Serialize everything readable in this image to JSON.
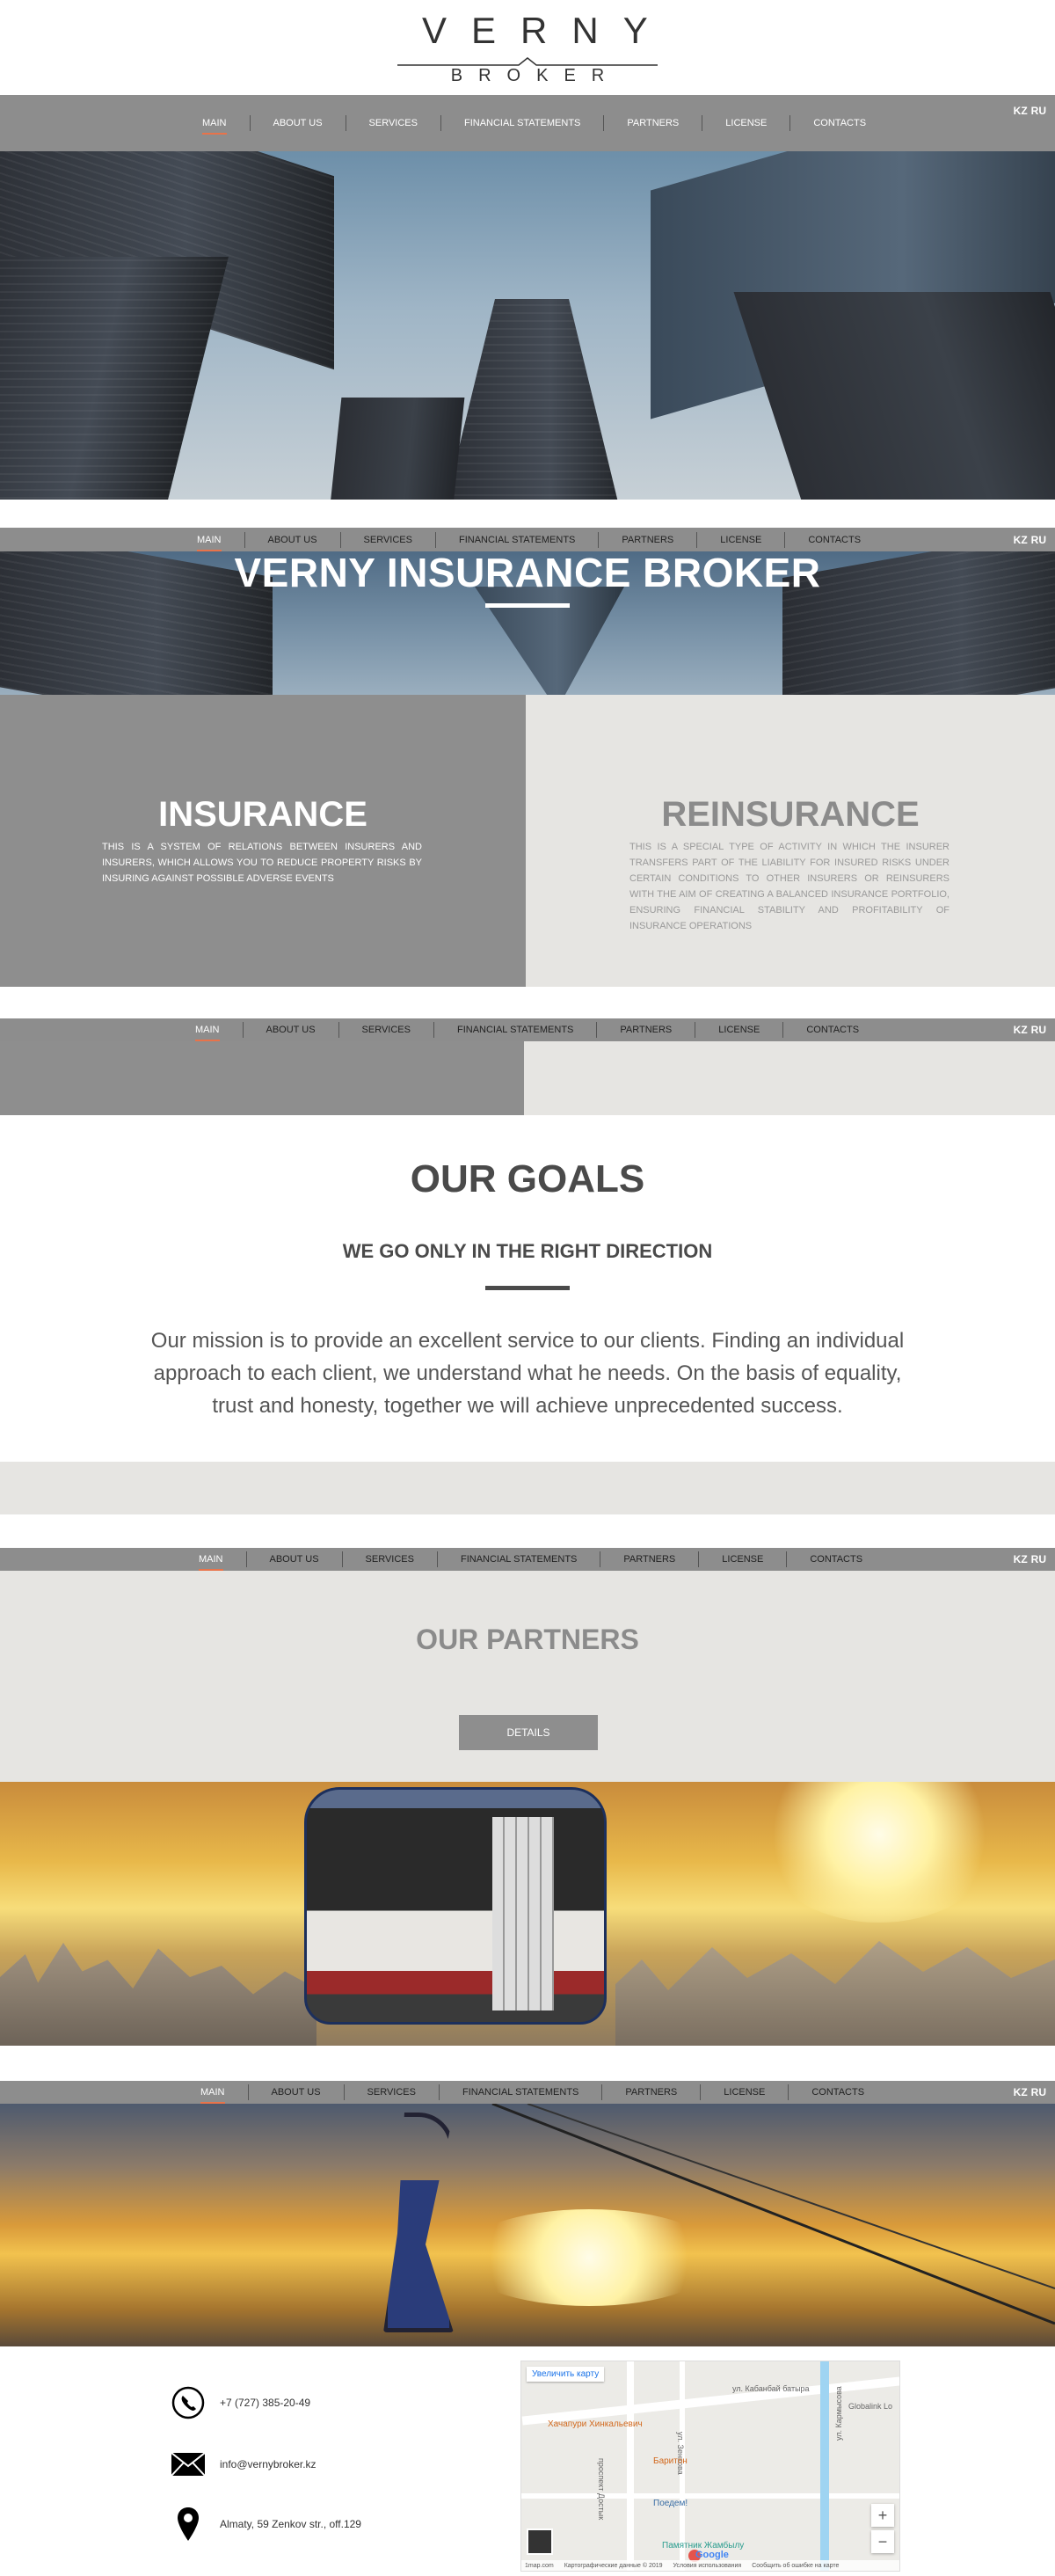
{
  "logo": {
    "title": "VERNY",
    "subtitle": "BROKER"
  },
  "nav": {
    "items": [
      "MAIN",
      "ABOUT US",
      "SERVICES",
      "FINANCIAL STATEMENTS",
      "PARTNERS",
      "LICENSE",
      "CONTACTS"
    ],
    "active": "MAIN",
    "lang_kz": "KZ",
    "lang_ru": "RU"
  },
  "hero": {
    "title": "VERNY INSURANCE BROKER"
  },
  "insurance": {
    "title": "INSURANCE",
    "text": "THIS IS A SYSTEM OF RELATIONS BETWEEN INSURERS AND INSURERS, WHICH ALLOWS YOU TO REDUCE PROPERTY RISKS BY INSURING AGAINST POSSIBLE ADVERSE EVENTS"
  },
  "reinsurance": {
    "title": "REINSURANCE",
    "text": "THIS IS A SPECIAL TYPE OF ACTIVITY IN WHICH THE INSURER TRANSFERS PART OF THE LIABILITY FOR INSURED RISKS UNDER CERTAIN CONDITIONS TO OTHER INSURERS OR REINSURERS WITH THE AIM OF CREATING A BALANCED INSURANCE PORTFOLIO, ENSURING FINANCIAL STABILITY AND PROFITABILITY OF INSURANCE OPERATIONS"
  },
  "goals": {
    "title": "OUR GOALS",
    "subtitle": "WE GO ONLY IN THE RIGHT DIRECTION",
    "text": "Our mission is to provide an excellent service to our clients. Finding an individual approach to each client, we understand what he needs. On the basis of equality, trust and honesty, together we will achieve unprecedented success."
  },
  "partners": {
    "title": "OUR PARTNERS",
    "button": "DETAILS"
  },
  "contacts": {
    "phone": "+7 (727) 385-20-49",
    "email": "info@vernybroker.kz",
    "address": "Almaty, 59 Zenkov str., off.129"
  },
  "map": {
    "enlarge": "Увеличить карту",
    "street_1": "ул. Кабанбай батыра",
    "street_2": "ул. Зенкова",
    "street_3": "проспект Достык",
    "street_4": "ул. Кармысова",
    "poi_1": "Хачапури Хинкальевич",
    "poi_2": "Баритон",
    "poi_3": "Поедем!",
    "poi_4": "Памятник Жамбылу",
    "poi_5": "Globalink Lo",
    "zoom_in": "+",
    "zoom_out": "−",
    "brand": "Google",
    "footer_1": "Картографические данные © 2019",
    "footer_2": "Условия использования",
    "footer_3": "Сообщить об ошибке на карте",
    "footer_4": "1map.com"
  },
  "colors": {
    "nav": "#8d8d8d",
    "accent": "#e8734a",
    "panel_dark": "#8e8e8e",
    "panel_light": "#e6e5e2"
  }
}
